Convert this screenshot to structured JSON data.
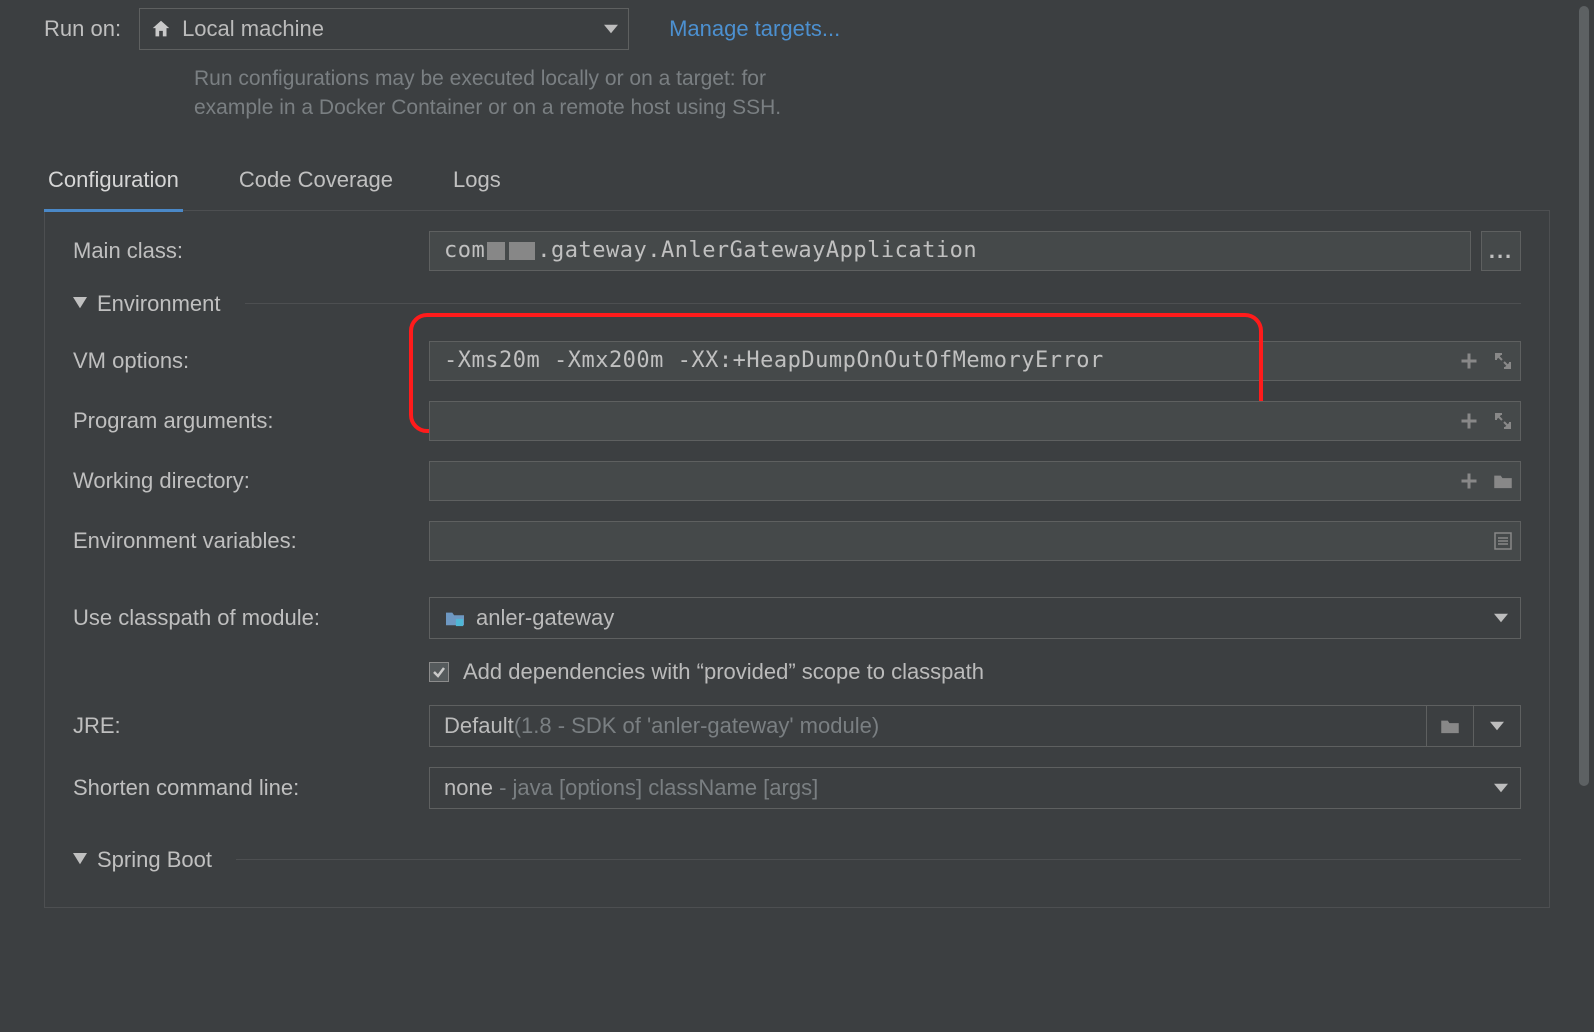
{
  "run_on": {
    "label": "Run on:",
    "selected": "Local machine",
    "manage_link": "Manage targets...",
    "help_line1": "Run configurations may be executed locally or on a target: for",
    "help_line2": "example in a Docker Container or on a remote host using SSH."
  },
  "tabs": {
    "configuration": "Configuration",
    "code_coverage": "Code Coverage",
    "logs": "Logs"
  },
  "form": {
    "main_class_label": "Main class:",
    "main_class_prefix": "com",
    "main_class_suffix": ".gateway.AnlerGatewayApplication",
    "browse_btn": "...",
    "environment_section": "Environment",
    "vm_options_label": "VM options:",
    "vm_options_value": "-Xms20m -Xmx200m -XX:+HeapDumpOnOutOfMemoryError",
    "program_args_label": "Program arguments:",
    "program_args_value": "",
    "working_dir_label": "Working directory:",
    "working_dir_value": "",
    "env_vars_label": "Environment variables:",
    "env_vars_value": "",
    "classpath_label": "Use classpath of module:",
    "classpath_value": "anler-gateway",
    "add_provided_label_pre": "Add dependencies with ",
    "add_provided_quoted": "provided",
    "add_provided_label_post": " scope to classpath",
    "jre_label": "JRE:",
    "jre_value": "Default",
    "jre_hint": " (1.8 - SDK of 'anler-gateway' module)",
    "shorten_label": "Shorten command line:",
    "shorten_value": "none",
    "shorten_hint": " - java [options] className [args]",
    "springboot_section": "Spring Boot"
  }
}
